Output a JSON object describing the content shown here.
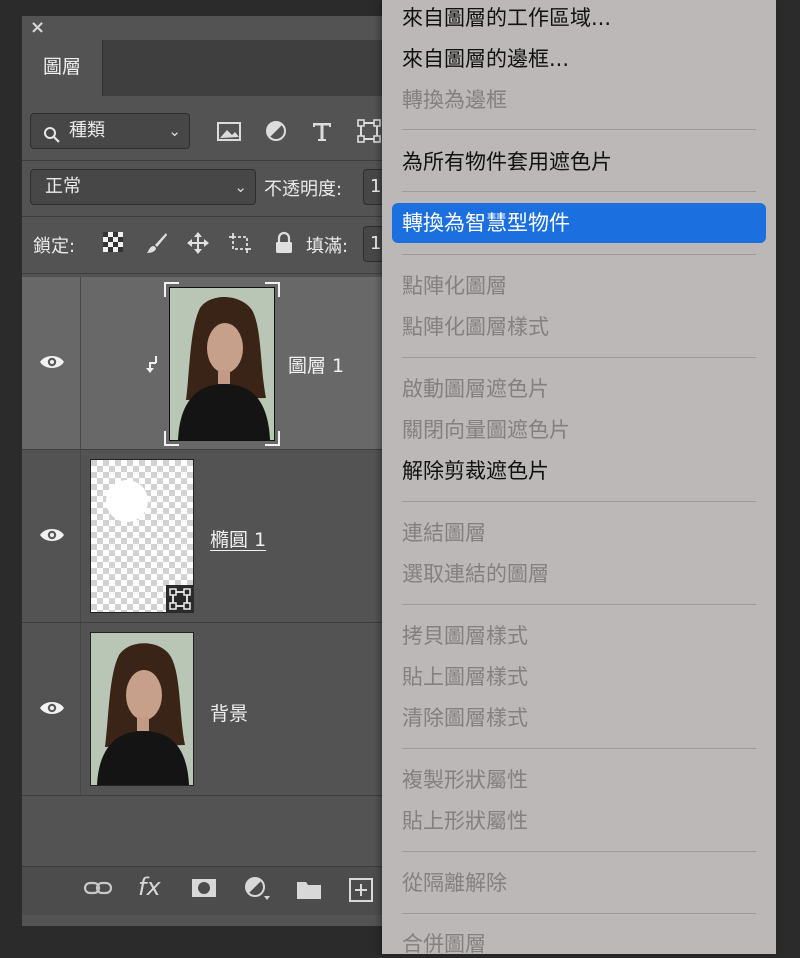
{
  "panel": {
    "close_label": "×",
    "tab_label": "圖層",
    "filter": {
      "label": "種類",
      "icon": "search-icon"
    },
    "filter_icons": [
      "image-filter-icon",
      "adjustment-filter-icon",
      "type-filter-icon",
      "shape-filter-icon"
    ],
    "blend_mode": "正常",
    "opacity_label": "不透明度:",
    "opacity_value": "1(",
    "lock_label": "鎖定:",
    "lock_icons": [
      "lock-transparent-pixels-icon",
      "lock-image-pixels-icon",
      "lock-position-icon",
      "lock-artboard-icon",
      "lock-all-icon"
    ],
    "fill_label": "填滿:",
    "fill_value": "1(",
    "layers": [
      {
        "name": "圖層 1",
        "visible": true,
        "clipped": true,
        "selected": true
      },
      {
        "name": "橢圓 1",
        "visible": true,
        "shape_layer": true
      },
      {
        "name": "背景",
        "visible": true
      }
    ],
    "bottom_icons": [
      "link-layers-icon",
      "fx-icon",
      "layer-mask-icon",
      "adjustment-layer-icon",
      "group-folder-icon",
      "new-layer-icon"
    ],
    "fx_label": "fx"
  },
  "menu": {
    "items": [
      {
        "label": "來自圖層的工作區域...",
        "enabled": true
      },
      {
        "label": "來自圖層的邊框...",
        "enabled": true
      },
      {
        "label": "轉換為邊框",
        "enabled": false
      },
      {
        "label": "為所有物件套用遮色片",
        "enabled": true
      },
      {
        "label": "轉換為智慧型物件",
        "enabled": true,
        "highlighted": true
      },
      {
        "label": "點陣化圖層",
        "enabled": false
      },
      {
        "label": "點陣化圖層樣式",
        "enabled": false
      },
      {
        "label": "啟動圖層遮色片",
        "enabled": false
      },
      {
        "label": "關閉向量圖遮色片",
        "enabled": false
      },
      {
        "label": "解除剪裁遮色片",
        "enabled": true
      },
      {
        "label": "連結圖層",
        "enabled": false
      },
      {
        "label": "選取連結的圖層",
        "enabled": false
      },
      {
        "label": "拷貝圖層樣式",
        "enabled": false
      },
      {
        "label": "貼上圖層樣式",
        "enabled": false
      },
      {
        "label": "清除圖層樣式",
        "enabled": false
      },
      {
        "label": "複製形狀屬性",
        "enabled": false
      },
      {
        "label": "貼上形狀屬性",
        "enabled": false
      },
      {
        "label": "從隔離解除",
        "enabled": false
      },
      {
        "label": "合併圖層",
        "enabled": false
      }
    ],
    "highlight_color": "#1b6fde"
  }
}
